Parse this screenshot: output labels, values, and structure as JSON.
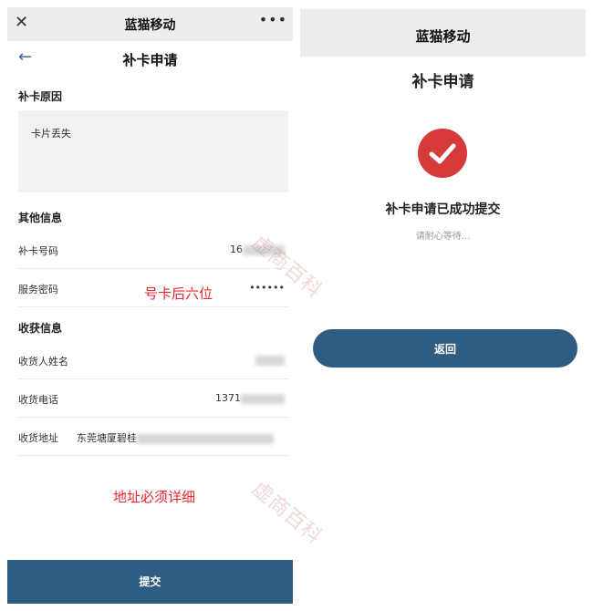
{
  "left": {
    "window_title": "蓝猫移动",
    "page_title": "补卡申请",
    "reason_section": "补卡原因",
    "reason_value": "卡片丢失",
    "other_section": "其他信息",
    "card_number_label": "补卡号码",
    "card_number_value": "16",
    "service_pwd_label": "服务密码",
    "service_pwd_value": "••••••",
    "annotation_pwd": "号卡后六位",
    "receive_section": "收获信息",
    "receiver_name_label": "收货人姓名",
    "receiver_phone_label": "收货电话",
    "receiver_phone_value": "1371",
    "address_label": "收货地址",
    "address_value": "东莞塘厦碧桂",
    "annotation_address": "地址必须详细",
    "submit_label": "提交"
  },
  "right": {
    "window_title": "蓝猫移动",
    "page_title": "补卡申请",
    "success_message": "补卡申请已成功提交",
    "wait_message": "请耐心等待...",
    "back_label": "返回"
  },
  "watermark": "虚商百科",
  "colors": {
    "primary": "#2f5c82",
    "success_red": "#d63a3a",
    "annotation": "#e8262b"
  },
  "icons": [
    "close-icon",
    "more-icon",
    "back-arrow-icon",
    "success-check-icon"
  ]
}
